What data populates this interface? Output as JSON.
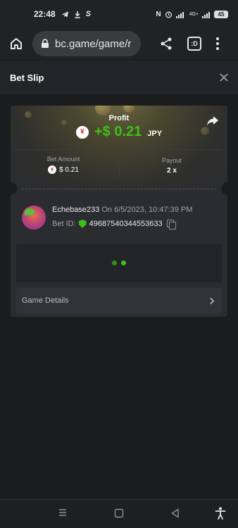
{
  "status_bar": {
    "time": "22:48",
    "signal_text": "4G+",
    "battery": "45"
  },
  "browser": {
    "url": "bc.game/game/r"
  },
  "bet_slip": {
    "title": "Bet Slip",
    "profit_label": "Profit",
    "profit_amount": "+$ 0.21",
    "profit_currency": "JPY",
    "bet_amount_label": "Bet Amount",
    "bet_amount_value": "$ 0.21",
    "payout_label": "Payout",
    "payout_value": "2 x",
    "player": {
      "username": "Echebase233",
      "date_text": "On 6/5/2023, 10:47:39 PM",
      "bet_id_label": "Bet ID:",
      "bet_id_value": "49687540344553633"
    },
    "game_details_label": "Game Details"
  },
  "icons": {
    "yen_symbol": "¥",
    "tabs_count": ":D"
  }
}
